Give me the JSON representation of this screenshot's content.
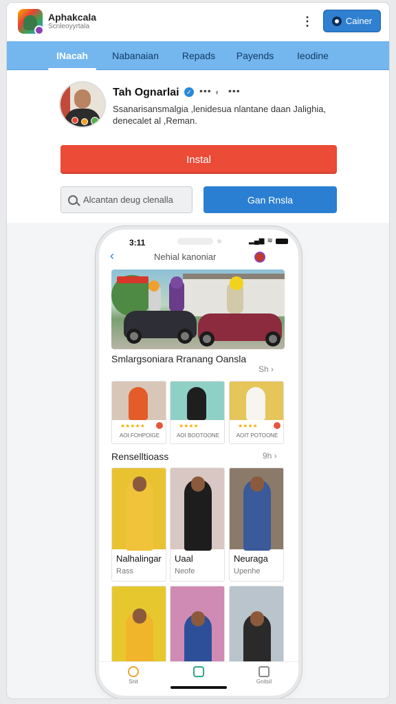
{
  "app": {
    "name": "Aphakcala",
    "subtitle": "Scnleoyyrtala",
    "action_label": "Cainer"
  },
  "tabs": [
    {
      "label": "INacah",
      "active": true
    },
    {
      "label": "Nabanaian",
      "active": false
    },
    {
      "label": "Repads",
      "active": false
    },
    {
      "label": "Payends",
      "active": false
    },
    {
      "label": "Ieodine",
      "active": false
    }
  ],
  "profile": {
    "name": "Tah Ognarlai",
    "dots": "•••",
    "description": "Ssanarisansmalgia ,lenidesua nlantane daan Jalighia, denecalet al ,Reman.",
    "install_label": "Instal",
    "search_placeholder": "Alcantan deug clenalla",
    "secondary_label": "Gan Rnsla"
  },
  "phone": {
    "time": "3:11",
    "title": "Nehial kanoniar",
    "section1": {
      "title": "Smlargsoniara Rranang Oansla",
      "more": "Sh"
    },
    "featured": [
      {
        "caption": "AOI FOHPOIGE",
        "stars": "★★★★★",
        "bg": "#d8c6b8",
        "fig": "#e35c2a"
      },
      {
        "caption": "AOI BOOTOONE",
        "stars": "★★★★",
        "bg": "#8fd0c6",
        "fig": "#1e1e1e"
      },
      {
        "caption": "AOIT POTOONE",
        "stars": "★★★★",
        "bg": "#e6c55a",
        "fig": "#f7f5f0"
      }
    ],
    "section2": {
      "title": "Renselltioass",
      "more": "9h"
    },
    "grid": [
      {
        "name": "Nalhalingar",
        "sub": "Rass",
        "bg": "#e9c232",
        "fig": "#f0c33a"
      },
      {
        "name": "Uaal",
        "sub": "Neofe",
        "bg": "#d8c7c2",
        "fig": "#1d1d1d"
      },
      {
        "name": "Neuraga",
        "sub": "Upenhe",
        "bg": "#8b7a6a",
        "fig": "#3a5a9a"
      },
      {
        "bg": "#e6c82e",
        "fig": "#f0b52a"
      },
      {
        "bg": "#cf8bb4",
        "fig": "#2d4f9a"
      },
      {
        "bg": "#b9c4cc",
        "fig": "#2a2a2a"
      }
    ],
    "tabbar": [
      {
        "label": "Snit"
      },
      {
        "label": ""
      },
      {
        "label": "Gnitsil"
      }
    ]
  },
  "colors": {
    "tab_bar": "#74b6ee",
    "install": "#eb4b37",
    "primary": "#2b7fd3"
  }
}
